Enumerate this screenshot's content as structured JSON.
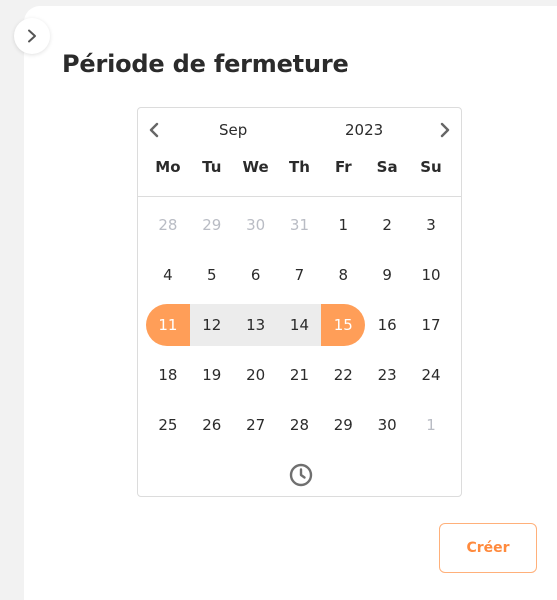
{
  "panel": {
    "title": "Période de fermeture",
    "collapse_icon": "chevron-right-icon"
  },
  "calendar": {
    "month": "Sep",
    "year": "2023",
    "prev_icon": "chevron-left-icon",
    "next_icon": "chevron-right-icon",
    "weekdays": [
      "Mo",
      "Tu",
      "We",
      "Th",
      "Fr",
      "Sa",
      "Su"
    ],
    "days": [
      {
        "label": "28",
        "muted": true
      },
      {
        "label": "29",
        "muted": true
      },
      {
        "label": "30",
        "muted": true
      },
      {
        "label": "31",
        "muted": true
      },
      {
        "label": "1"
      },
      {
        "label": "2"
      },
      {
        "label": "3"
      },
      {
        "label": "4"
      },
      {
        "label": "5"
      },
      {
        "label": "6"
      },
      {
        "label": "7"
      },
      {
        "label": "8"
      },
      {
        "label": "9"
      },
      {
        "label": "10"
      },
      {
        "label": "11",
        "state": "range-start"
      },
      {
        "label": "12",
        "state": "in-range"
      },
      {
        "label": "13",
        "state": "in-range"
      },
      {
        "label": "14",
        "state": "in-range"
      },
      {
        "label": "15",
        "state": "range-end"
      },
      {
        "label": "16"
      },
      {
        "label": "17"
      },
      {
        "label": "18"
      },
      {
        "label": "19"
      },
      {
        "label": "20"
      },
      {
        "label": "21"
      },
      {
        "label": "22"
      },
      {
        "label": "23"
      },
      {
        "label": "24"
      },
      {
        "label": "25"
      },
      {
        "label": "26"
      },
      {
        "label": "27"
      },
      {
        "label": "28"
      },
      {
        "label": "29"
      },
      {
        "label": "30"
      },
      {
        "label": "1",
        "muted": true
      }
    ],
    "time_icon": "clock-icon"
  },
  "actions": {
    "create_label": "Créer"
  },
  "colors": {
    "accent": "#ff9e58",
    "range_fill": "#ececec",
    "muted_text": "#b9bcc4"
  }
}
